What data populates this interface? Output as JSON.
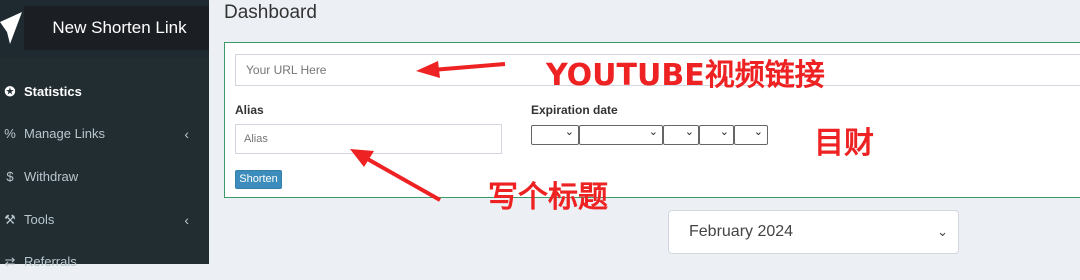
{
  "sidebar": {
    "new_link_label": "New Shorten Link",
    "items": [
      {
        "label": "Statistics",
        "icon": "dashboard-icon",
        "glyph": "✪",
        "active": true,
        "chevron": ""
      },
      {
        "label": "Manage Links",
        "icon": "link-icon",
        "glyph": "%",
        "active": false,
        "chevron": "‹"
      },
      {
        "label": "Withdraw",
        "icon": "dollar-icon",
        "glyph": "$",
        "active": false,
        "chevron": ""
      },
      {
        "label": "Tools",
        "icon": "wrench-icon",
        "glyph": "⚒",
        "active": false,
        "chevron": "‹"
      },
      {
        "label": "Referrals",
        "icon": "exchange-icon",
        "glyph": "⇄",
        "active": false,
        "chevron": ""
      }
    ]
  },
  "main": {
    "title": "Dashboard",
    "form": {
      "url_placeholder": "Your URL Here",
      "alias_label": "Alias",
      "alias_placeholder": "Alias",
      "expiration_label": "Expiration date",
      "shorten_label": "Shorten"
    },
    "month_select_value": "February 2024"
  },
  "annotations": {
    "youtube_link": "YOUTUBE视频链接",
    "target": "目财",
    "title_hint": "写个标题"
  },
  "colors": {
    "sidebar_bg": "#222d32",
    "accent": "#3c8dbc",
    "card_border": "#3c9a6a",
    "annotation": "#ee2222"
  }
}
